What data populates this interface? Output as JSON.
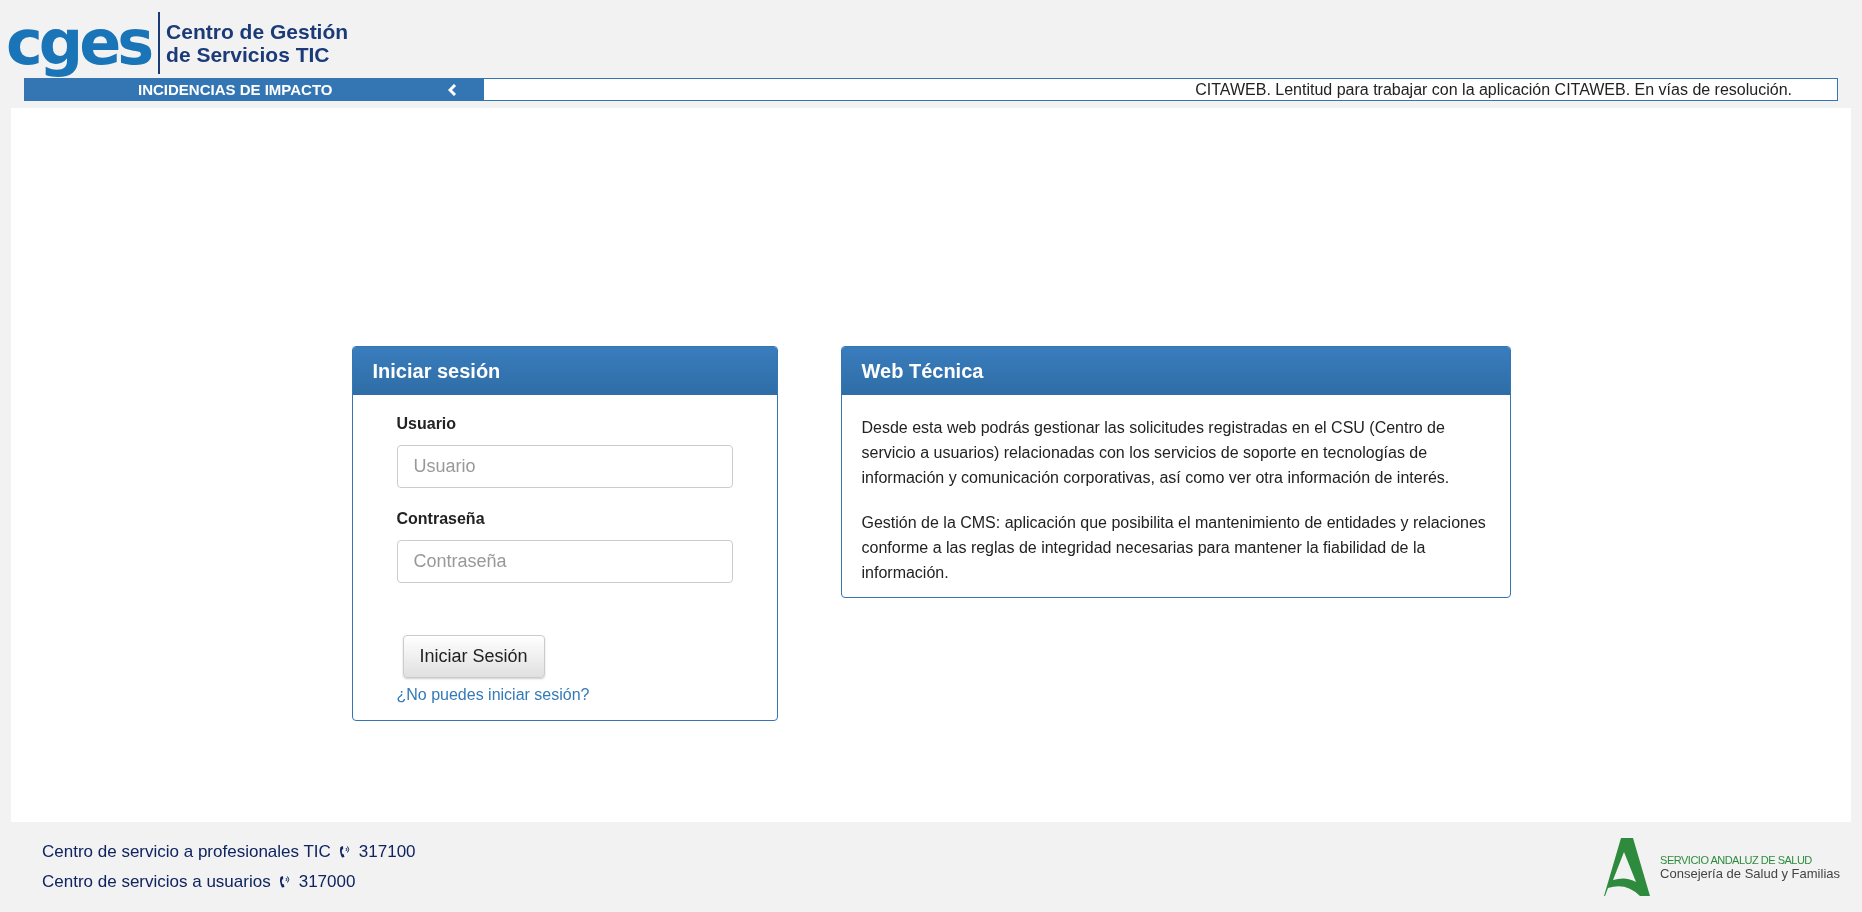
{
  "logo": {
    "mark": "cges",
    "title_lines": [
      "Centro de Gestión",
      "de Servicios TIC"
    ]
  },
  "incidents_bar": {
    "label": "INCIDENCIAS DE IMPACTO",
    "ticker": "CITAWEB. Lentitud para trabajar con la aplicación CITAWEB. En vías de resolución."
  },
  "login_panel": {
    "title": "Iniciar sesión",
    "fields": [
      {
        "label": "Usuario",
        "placeholder": "Usuario"
      },
      {
        "label": "Contraseña",
        "placeholder": "Contraseña"
      }
    ],
    "submit": "Iniciar Sesión",
    "help_link": "¿No puedes iniciar sesión?"
  },
  "info_panel": {
    "title": "Web Técnica",
    "paragraphs": [
      "Desde esta web podrás gestionar las solicitudes registradas en el CSU (Centro de servicio a usuarios) relacionadas con los servicios de soporte en tecnologías de información y comunicación corporativas, así como ver otra información de interés.",
      "Gestión de la CMS: aplicación que posibilita el mantenimiento de entidades y relaciones conforme a las reglas de integridad necesarias para mantener la fiabilidad de la información."
    ]
  },
  "footer": {
    "contacts": [
      {
        "name": "Centro de servicio a profesionales TIC",
        "phone": "317100"
      },
      {
        "name": "Centro de servicios a usuarios",
        "phone": "317000"
      }
    ],
    "sponsor": {
      "line_1": "SERVICIO ANDALUZ DE SALUD",
      "line_2": "Consejería de Salud y Familias"
    }
  }
}
